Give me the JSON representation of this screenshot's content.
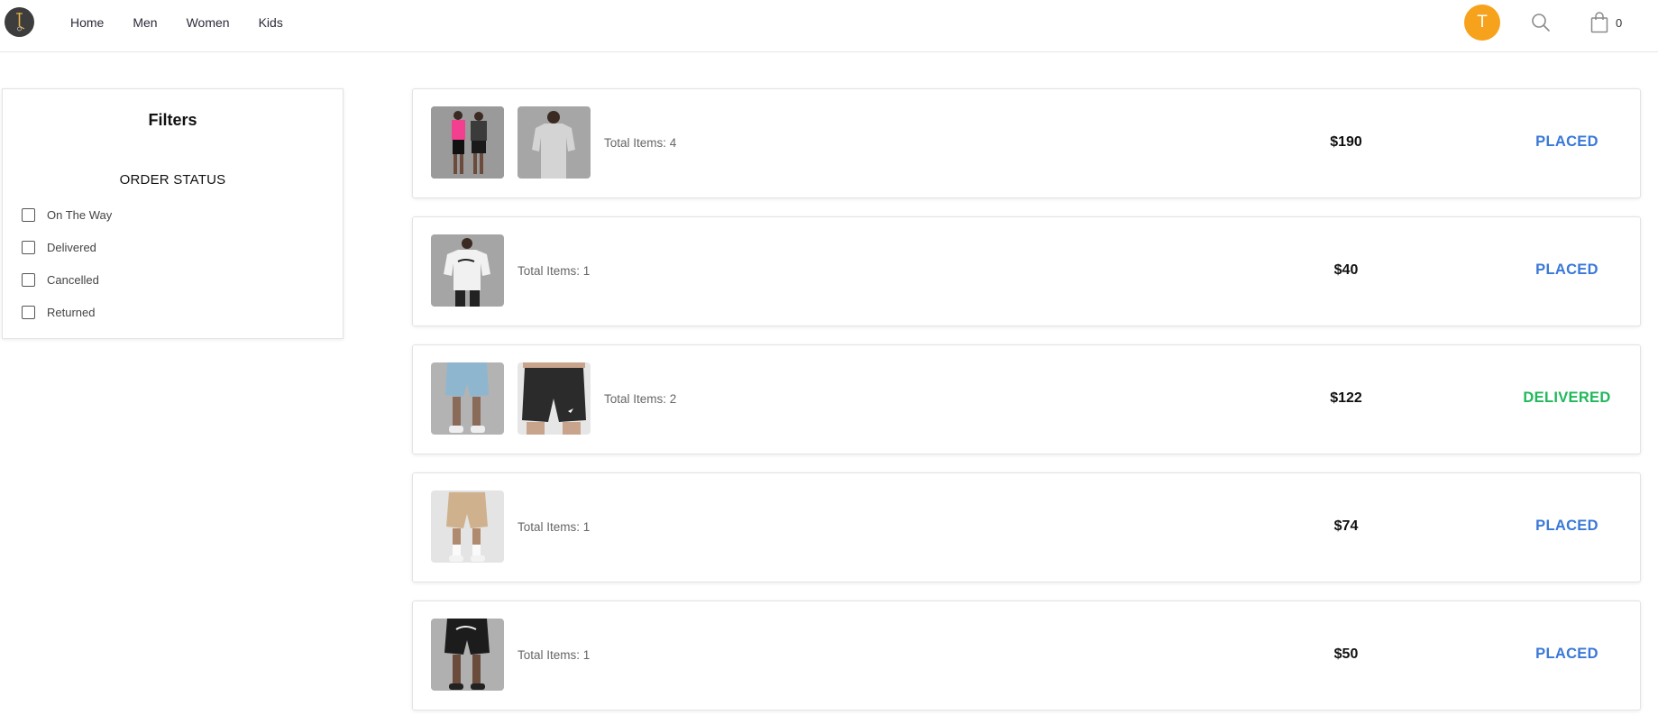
{
  "header": {
    "nav": [
      "Home",
      "Men",
      "Women",
      "Kids"
    ],
    "avatar_initial": "T",
    "cart_count": "0"
  },
  "filters": {
    "title": "Filters",
    "status_heading": "ORDER STATUS",
    "options": [
      "On The Way",
      "Delivered",
      "Cancelled",
      "Returned"
    ]
  },
  "orders": [
    {
      "total_items": "Total Items: 4",
      "price": "$190",
      "status": "PLACED",
      "thumbs": [
        "two-models-outfit-image",
        "grey-tshirt-image"
      ]
    },
    {
      "total_items": "Total Items: 1",
      "price": "$40",
      "status": "PLACED",
      "thumbs": [
        "white-graphic-tshirt-image"
      ]
    },
    {
      "total_items": "Total Items: 2",
      "price": "$122",
      "status": "DELIVERED",
      "thumbs": [
        "blue-shorts-image",
        "black-shorts-image"
      ]
    },
    {
      "total_items": "Total Items: 1",
      "price": "$74",
      "status": "PLACED",
      "thumbs": [
        "khaki-shorts-image"
      ]
    },
    {
      "total_items": "Total Items: 1",
      "price": "$50",
      "status": "PLACED",
      "thumbs": [
        "black-graphic-shorts-image"
      ]
    }
  ],
  "colors": {
    "placed": "#3a78d8",
    "delivered": "#1fb85a",
    "avatar": "#f6a21d"
  }
}
